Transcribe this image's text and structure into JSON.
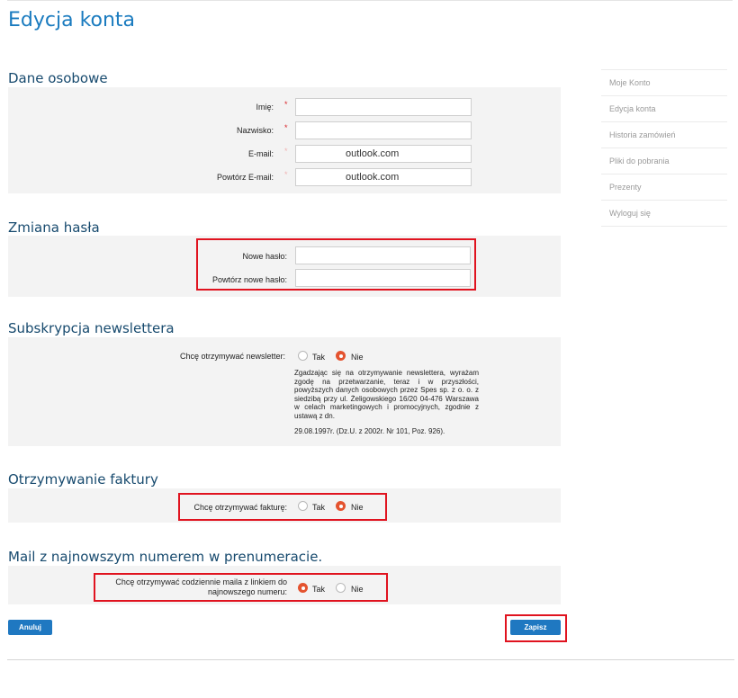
{
  "page_title": "Edycja konta",
  "personal": {
    "title": "Dane osobowe",
    "fields": [
      {
        "label": "Imię:",
        "required": "*",
        "value": ""
      },
      {
        "label": "Nazwisko:",
        "required": "*",
        "value": ""
      },
      {
        "label": "E-mail:",
        "required": "*",
        "value": "outlook.com"
      },
      {
        "label": "Powtórz E-mail:",
        "required": "*",
        "value": "outlook.com"
      }
    ]
  },
  "password": {
    "title": "Zmiana hasła",
    "fields": [
      {
        "label": "Nowe hasło:",
        "value": ""
      },
      {
        "label": "Powtórz nowe hasło:",
        "value": ""
      }
    ]
  },
  "newsletter": {
    "title": "Subskrypcja newslettera",
    "question": "Chcę otrzymywać newsletter:",
    "options": [
      "Tak",
      "Nie"
    ],
    "selected": "Nie",
    "consent": "Zgadzając się na otrzymywanie newslettera, wyrażam zgodę na przetwarzanie, teraz i w przyszłości, powyższych danych osobowych przez Spes sp. z o. o. z siedzibą przy ul. Żeligowskiego 16/20 04-476 Warszawa w celach marketingowych i promocyjnych, zgodnie z ustawą z dn.",
    "consent_end": "29.08.1997r. (Dz.U. z 2002r. Nr 101, Poz. 926)."
  },
  "invoice": {
    "title": "Otrzymywanie faktury",
    "question": "Chcę otrzymywać fakturę:",
    "options": [
      "Tak",
      "Nie"
    ],
    "selected": "Nie"
  },
  "mail": {
    "title": "Mail z najnowszym numerem w prenumeracie.",
    "question_line1": "Chcę otrzymywać codziennie maila z linkiem do",
    "question_line2": "najnowszego numeru:",
    "options": [
      "Tak",
      "Nie"
    ],
    "selected": "Tak"
  },
  "buttons": {
    "cancel": "Anuluj",
    "save": "Zapisz"
  },
  "sidebar": {
    "items": [
      {
        "label": "Moje Konto"
      },
      {
        "label": "Edycja konta"
      },
      {
        "label": "Historia zamówień"
      },
      {
        "label": "Pliki do pobrania"
      },
      {
        "label": "Prezenty"
      },
      {
        "label": "Wyloguj się"
      }
    ]
  },
  "colors": {
    "accent": "#1a7bbf",
    "highlight": "#e0131f",
    "radio_checked": "#e4532f",
    "button": "#1f78c1"
  }
}
